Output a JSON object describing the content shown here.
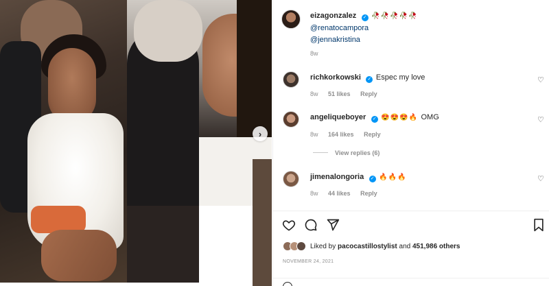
{
  "post": {
    "author": "eizagonzalez",
    "caption_emoji": "🥀🥀🥀🥀🥀",
    "mentions": [
      "@renatocampora",
      "@jennakristina"
    ],
    "time": "8w",
    "next_icon": "chevron-right-icon"
  },
  "comments": [
    {
      "user": "richkorkowski",
      "text": "Espec my love",
      "time": "8w",
      "likes": "51 likes",
      "reply": "Reply"
    },
    {
      "user": "angeliqueboyer",
      "emoji": "😍😍😍🔥",
      "text": "OMG",
      "time": "8w",
      "likes": "164 likes",
      "reply": "Reply",
      "view_replies": "View replies (6)"
    },
    {
      "user": "jimenalongoria",
      "emoji": "🔥🔥🔥",
      "text": "",
      "time": "8w",
      "likes": "44 likes",
      "reply": "Reply"
    }
  ],
  "likes": {
    "prefix": "Liked by",
    "user": "pacocastillostylist",
    "and": "and",
    "others": "451,986 others"
  },
  "date": "NOVEMBER 24, 2021",
  "colors": {
    "verified": "#0095f6",
    "link": "#00376b",
    "muted": "#8e8e8e"
  }
}
